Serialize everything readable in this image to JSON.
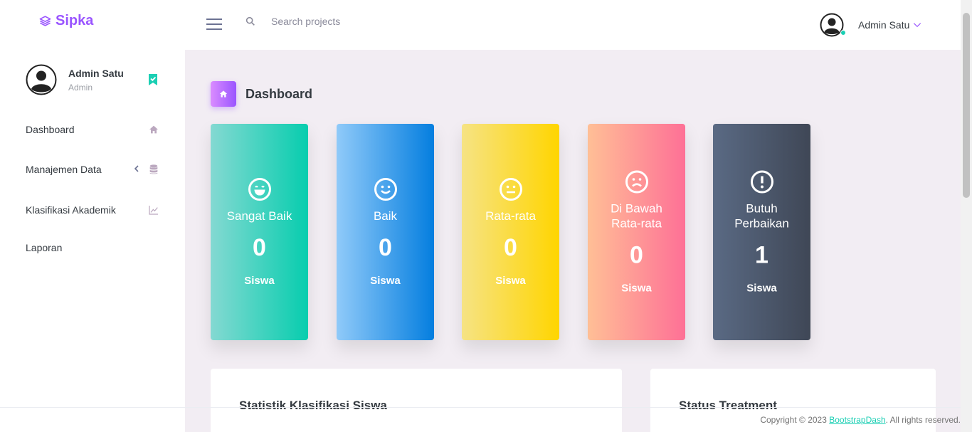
{
  "brand": {
    "name": "Sipka",
    "color": "#9a55ff"
  },
  "navbar": {
    "search_placeholder": "Search projects",
    "user_name": "Admin Satu"
  },
  "sidebar": {
    "user": {
      "name": "Admin Satu",
      "role": "Admin"
    },
    "items": [
      {
        "label": "Dashboard",
        "icon": "home-icon"
      },
      {
        "label": "Manajemen Data",
        "icon": "database-icon"
      },
      {
        "label": "Klasifikasi Akademik",
        "icon": "chart-line-icon"
      },
      {
        "label": "Laporan"
      }
    ]
  },
  "page": {
    "title": "Dashboard"
  },
  "cards": [
    {
      "title": "Sangat Baik",
      "value": "0",
      "unit": "Siswa",
      "icon": "happy-face-icon",
      "color": "#07cdae"
    },
    {
      "title": "Baik",
      "value": "0",
      "unit": "Siswa",
      "icon": "smile-face-icon",
      "color": "#047edf"
    },
    {
      "title": "Rata-rata",
      "value": "0",
      "unit": "Siswa",
      "icon": "neutral-face-icon",
      "color": "#ffd500"
    },
    {
      "title": "Di Bawah Rata-rata",
      "value": "0",
      "unit": "Siswa",
      "icon": "sad-face-icon",
      "color": "#fe7096"
    },
    {
      "title": "Butuh Perbaikan",
      "value": "1",
      "unit": "Siswa",
      "icon": "alert-circle-icon",
      "color": "#3f4756"
    }
  ],
  "panels": {
    "statistics_title": "Statistik Klasifikasi Siswa",
    "status_title": "Status Treatment"
  },
  "footer": {
    "prefix": "Copyright © 2023 ",
    "link": "BootstrapDash",
    "suffix": ". All rights reserved."
  }
}
